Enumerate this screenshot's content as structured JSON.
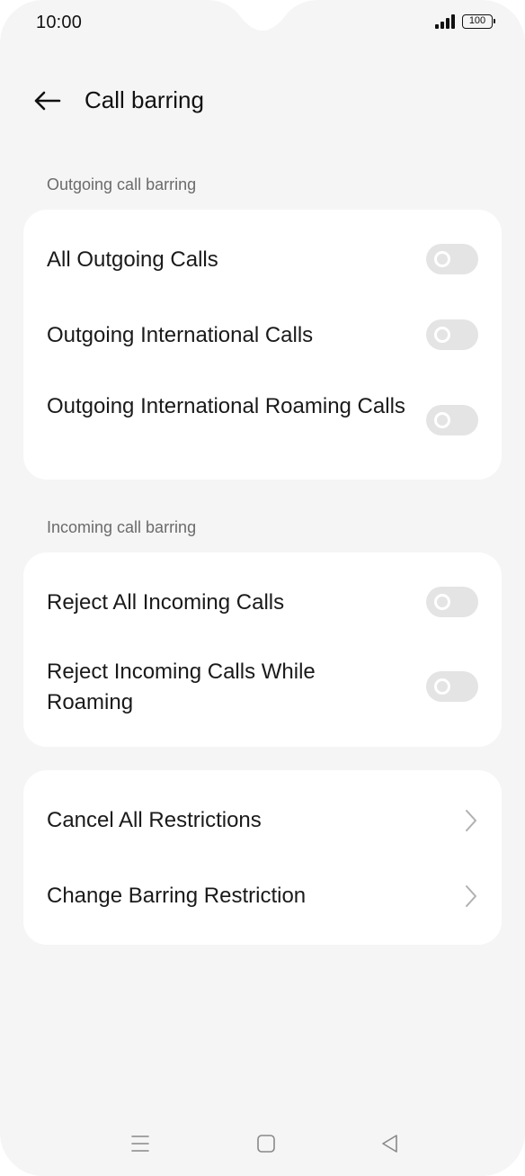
{
  "status_bar": {
    "time": "10:00",
    "battery": "100",
    "icons": [
      "signal-icon",
      "battery-icon"
    ]
  },
  "header": {
    "title": "Call barring",
    "back_icon": "arrow-left-icon"
  },
  "sections": {
    "outgoing": {
      "label": "Outgoing call barring",
      "items": [
        {
          "label": "All Outgoing Calls",
          "enabled": false
        },
        {
          "label": "Outgoing International Calls",
          "enabled": false
        },
        {
          "label": "Outgoing International Roaming Calls",
          "enabled": false
        }
      ]
    },
    "incoming": {
      "label": "Incoming call barring",
      "items": [
        {
          "label": "Reject All Incoming Calls",
          "enabled": false
        },
        {
          "label": "Reject Incoming Calls While Roaming",
          "enabled": false
        }
      ]
    },
    "actions": {
      "items": [
        {
          "label": "Cancel All Restrictions",
          "icon": "chevron-right-icon"
        },
        {
          "label": "Change Barring Restriction",
          "icon": "chevron-right-icon"
        }
      ]
    }
  },
  "nav_bar": {
    "icons": [
      "menu-icon",
      "home-icon",
      "back-triangle-icon"
    ]
  },
  "colors": {
    "background": "#f5f5f5",
    "card": "#ffffff",
    "toggle_off": "#e4e4e4",
    "text_primary": "#1a1a1a",
    "text_secondary": "#6b6b6b"
  }
}
